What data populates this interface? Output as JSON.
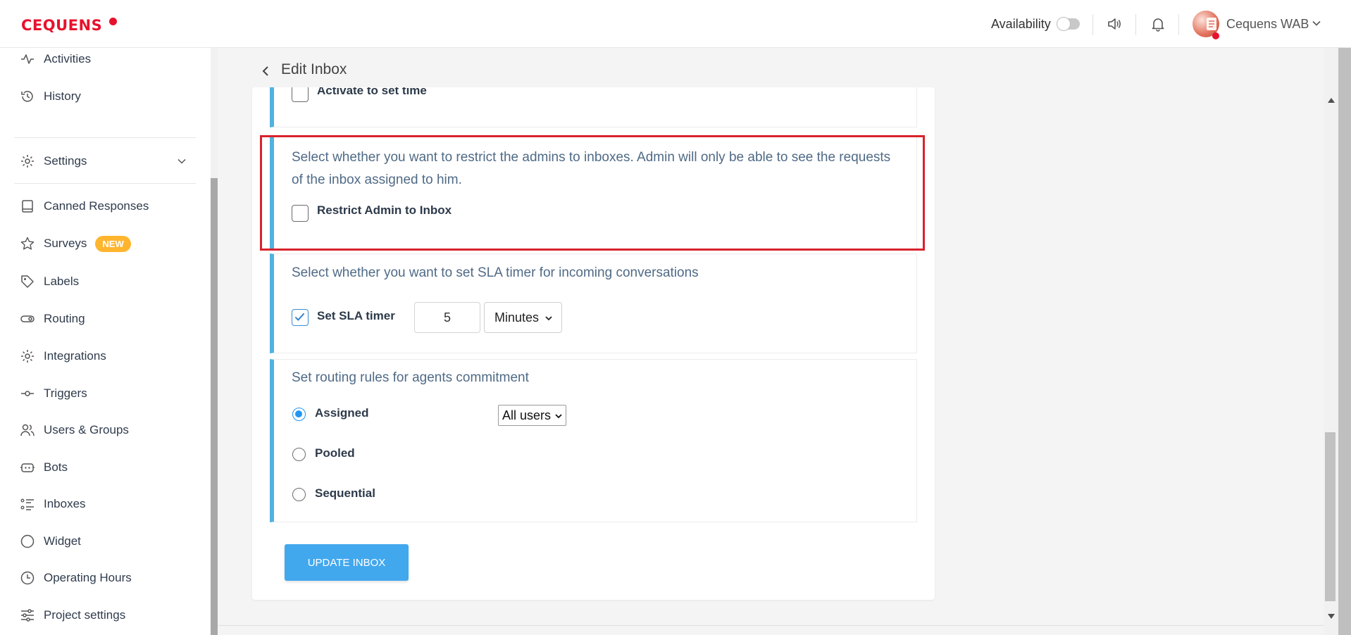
{
  "brand": {
    "logo_text": "CEQUENS",
    "accent": "#e8112d"
  },
  "header": {
    "availability_label": "Availability",
    "availability_on": false,
    "icons": [
      "speaker-icon",
      "bell-icon"
    ],
    "user_name": "Cequens WAB"
  },
  "sidebar": {
    "items": [
      {
        "label": "Activities",
        "icon": "activity-icon"
      },
      {
        "label": "History",
        "icon": "history-icon"
      },
      {
        "label": "Settings",
        "icon": "gear-icon",
        "expandable": true
      },
      {
        "label": "Canned Responses",
        "icon": "book-icon"
      },
      {
        "label": "Surveys",
        "icon": "star-icon",
        "badge": "NEW"
      },
      {
        "label": "Labels",
        "icon": "tag-icon"
      },
      {
        "label": "Routing",
        "icon": "routing-icon"
      },
      {
        "label": "Integrations",
        "icon": "gear-icon"
      },
      {
        "label": "Triggers",
        "icon": "trigger-icon"
      },
      {
        "label": "Users & Groups",
        "icon": "users-icon"
      },
      {
        "label": "Bots",
        "icon": "bot-icon"
      },
      {
        "label": "Inboxes",
        "icon": "list-icon"
      },
      {
        "label": "Widget",
        "icon": "circle-icon"
      },
      {
        "label": "Operating Hours",
        "icon": "clock-icon"
      },
      {
        "label": "Project settings",
        "icon": "sliders-icon"
      }
    ]
  },
  "page": {
    "title": "Edit Inbox"
  },
  "form": {
    "activate_time": {
      "label": "Activate to set time",
      "checked": false
    },
    "restrict_admin": {
      "description": "Select whether you want to restrict the admins to inboxes. Admin will only be able to see the requests of the inbox assigned to him.",
      "label": "Restrict Admin to Inbox",
      "checked": false
    },
    "sla": {
      "description": "Select whether you want to set SLA timer for incoming conversations",
      "label": "Set SLA timer",
      "checked": true,
      "value": "5",
      "unit": "Minutes"
    },
    "routing": {
      "description": "Set routing rules for agents commitment",
      "options": [
        "Assigned",
        "Pooled",
        "Sequential"
      ],
      "selected": "Assigned",
      "assigned_scope": "All users"
    },
    "submit_label": "UPDATE INBOX"
  },
  "colors": {
    "section_border": "#4fb3e1",
    "primary_button": "#42a8ee",
    "highlight": "#d9232d",
    "badge": "#ffb52e"
  }
}
